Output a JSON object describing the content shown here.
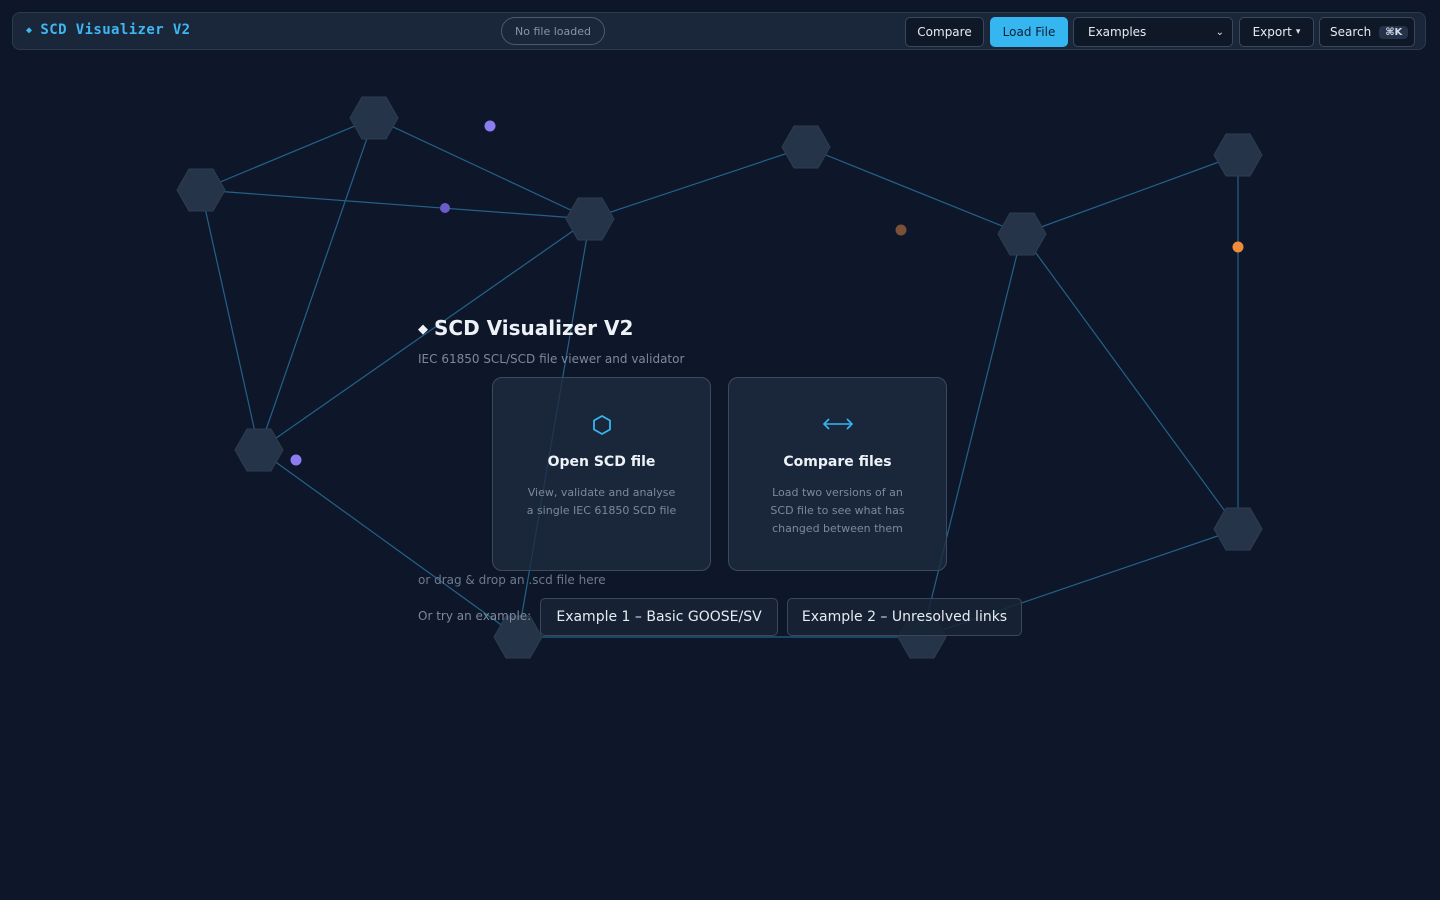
{
  "header": {
    "brand": "SCD Visualizer V2",
    "file_status": "No file loaded",
    "compare_label": "Compare",
    "load_label": "Load File",
    "examples_selected": "Examples",
    "export_label": "Export",
    "search_label": "Search",
    "search_shortcut": "⌘K"
  },
  "hero": {
    "title": "SCD Visualizer V2",
    "subtitle": "IEC 61850 SCL/SCD file viewer and validator"
  },
  "cards": {
    "open": {
      "icon": "hexagon-icon",
      "title": "Open SCD file",
      "description": "View, validate and analyse a single IEC 61850 SCD file"
    },
    "compare": {
      "icon": "arrows-horizontal-icon",
      "title": "Compare files",
      "description": "Load two versions of an SCD file to see what has changed between them"
    }
  },
  "drop_hint": "or drag & drop an .scd file here",
  "examples": {
    "label": "Or try an example:",
    "items": [
      "Example 1 – Basic GOOSE/SV",
      "Example 2 – Unresolved links"
    ]
  },
  "colors": {
    "background": "#0e1729",
    "accent": "#35b6f0",
    "node": "#253448",
    "edge": "#24618a",
    "dot_purple": "#8b7df0",
    "dot_orange": "#ef8c3c",
    "dot_brown": "#7a5036"
  }
}
